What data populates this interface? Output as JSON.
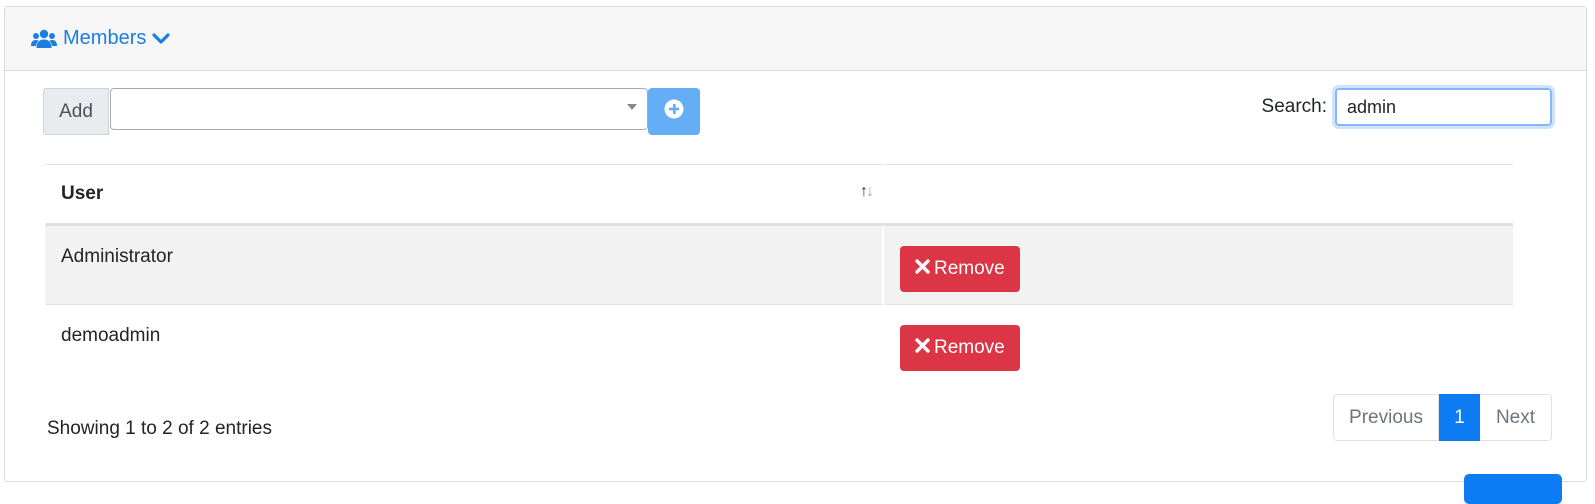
{
  "header": {
    "title": "Members",
    "icon": "users-icon",
    "toggle_icon": "chevron-down-icon",
    "accent_color": "#1a7fe0"
  },
  "add": {
    "label": "Add",
    "select_value": "",
    "button_icon": "plus-circle-icon"
  },
  "search": {
    "label": "Search:",
    "value": "admin"
  },
  "table": {
    "columns": [
      "User",
      ""
    ],
    "rows": [
      {
        "user": "Administrator",
        "action_label": "Remove"
      },
      {
        "user": "demoadmin",
        "action_label": "Remove"
      }
    ]
  },
  "footer": {
    "info": "Showing 1 to 2 of 2 entries",
    "pagination": {
      "previous": "Previous",
      "current": "1",
      "next": "Next"
    }
  },
  "colors": {
    "danger": "#dc3545",
    "primary": "#0d7cf2"
  }
}
